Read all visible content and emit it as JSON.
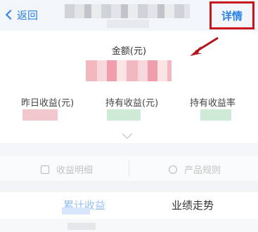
{
  "header": {
    "back_label": "返回",
    "detail_label": "详情"
  },
  "summary": {
    "amount_label": "金额(元)",
    "metrics": [
      {
        "label": "昨日收益(元)",
        "color": "#f2c7cd"
      },
      {
        "label": "持有收益(元)",
        "color": "#cfead7"
      },
      {
        "label": "持有收益率",
        "color": "#cfead7"
      }
    ]
  },
  "actions": {
    "left_label": "收益明细",
    "right_label": "产品规则"
  },
  "tabs": [
    {
      "label": "累计收益"
    },
    {
      "label": "业绩走势"
    }
  ],
  "colors": {
    "accent_blue": "#2a82e4",
    "highlight_red": "#c8141c"
  }
}
